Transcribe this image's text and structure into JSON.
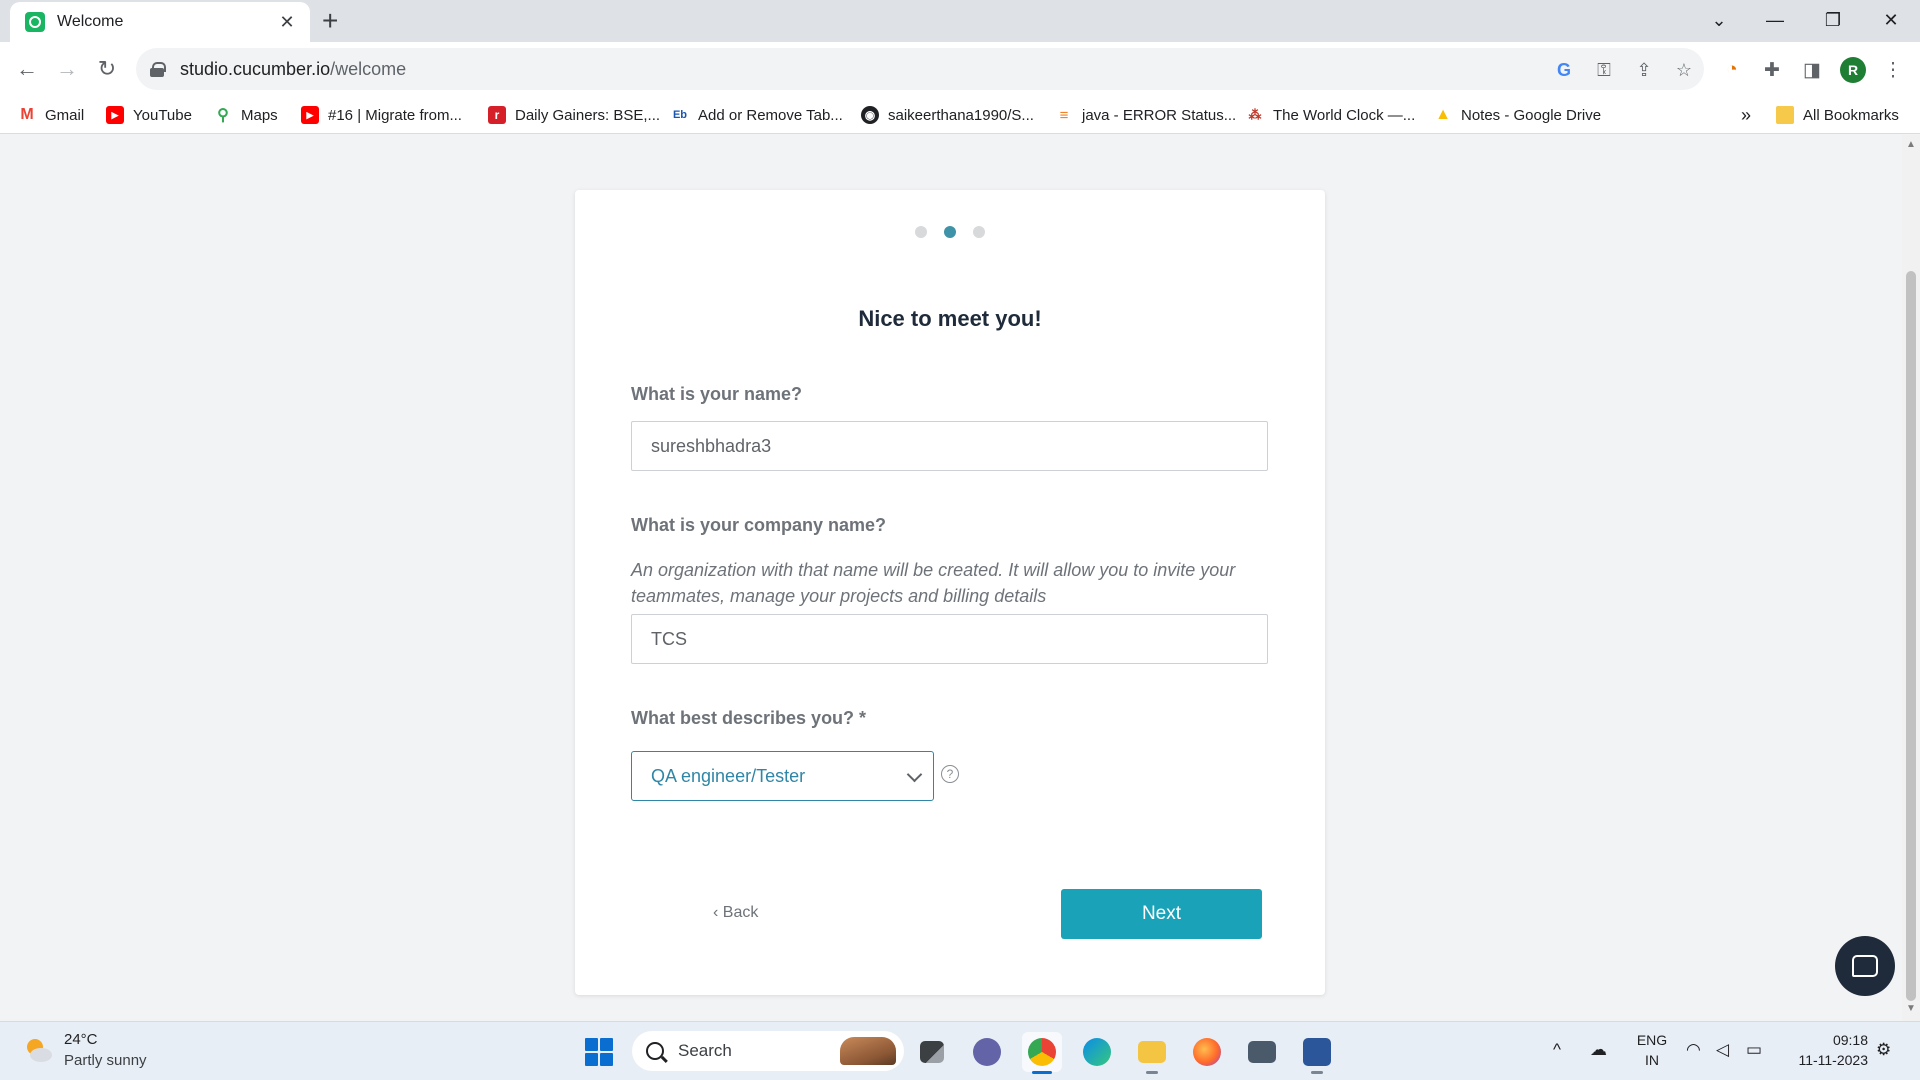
{
  "browser": {
    "tab_title": "Welcome",
    "url_host": "studio.cucumber.io",
    "url_path": "/welcome",
    "profile_initial": "R",
    "bookmarks": [
      {
        "label": "Gmail",
        "icon": "gmail-icon"
      },
      {
        "label": "YouTube",
        "icon": "youtube-icon"
      },
      {
        "label": "Maps",
        "icon": "maps-icon"
      },
      {
        "label": "#16 | Migrate from...",
        "icon": "youtube-icon"
      },
      {
        "label": "Daily Gainers: BSE,...",
        "icon": "rediff-icon"
      },
      {
        "label": "Add or Remove Tab...",
        "icon": "extendoffice-icon"
      },
      {
        "label": "saikeerthana1990/S...",
        "icon": "github-icon"
      },
      {
        "label": "java - ERROR Status...",
        "icon": "stackoverflow-icon"
      },
      {
        "label": "The World Clock —...",
        "icon": "worldclock-icon"
      },
      {
        "label": "Notes - Google Drive",
        "icon": "google-drive-icon"
      }
    ],
    "all_bookmarks_label": "All Bookmarks",
    "overflow_label": "»"
  },
  "onboarding": {
    "step_current": 2,
    "step_total": 3,
    "heading": "Nice to meet you!",
    "name_label": "What is your name?",
    "name_value": "sureshbhadra3",
    "company_label": "What is your company name?",
    "company_helper": "An organization with that name will be created. It will allow you to invite your teammates, manage your projects and billing details",
    "company_value": "TCS",
    "role_label": "What best describes you? *",
    "role_value": "QA engineer/Tester",
    "help_glyph": "?",
    "back_label": "‹ Back",
    "next_label": "Next"
  },
  "taskbar": {
    "weather_temp": "24°C",
    "weather_desc": "Partly sunny",
    "search_label": "Search",
    "lang_line1": "ENG",
    "lang_line2": "IN",
    "time": "09:18",
    "date": "11-11-2023"
  },
  "colors": {
    "accent": "#1aa2b8",
    "select_border": "#2f86a6",
    "active_step": "#3f93a8"
  }
}
